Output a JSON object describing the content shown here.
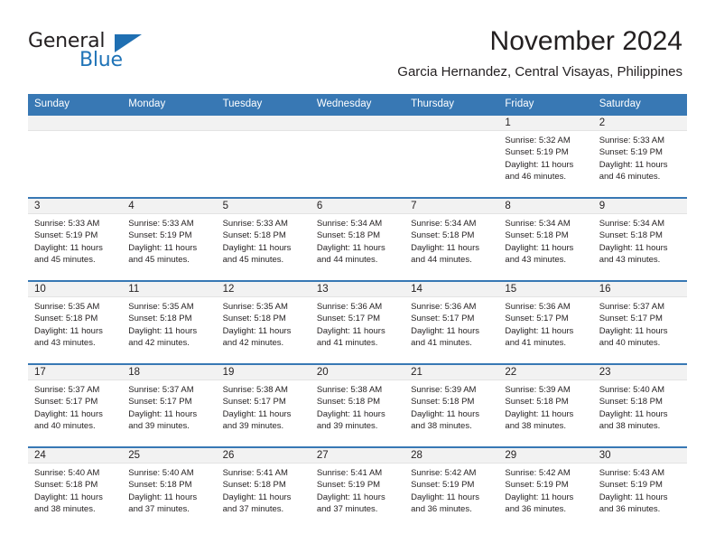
{
  "brand": {
    "word_top": "General",
    "word_bottom": "Blue",
    "triangle_color": "#1f6fb2",
    "blue_color": "#1f73b7"
  },
  "header": {
    "month_year": "November 2024",
    "location": "Garcia Hernandez, Central Visayas, Philippines",
    "header_bg_color": "#3878b4",
    "daynum_bg_color": "#f2f2f2"
  },
  "weekday_headers": [
    "Sunday",
    "Monday",
    "Tuesday",
    "Wednesday",
    "Thursday",
    "Friday",
    "Saturday"
  ],
  "weeks": [
    [
      {
        "day": "",
        "sunrise": "",
        "sunset": "",
        "daylight_line1": "",
        "daylight_line2": ""
      },
      {
        "day": "",
        "sunrise": "",
        "sunset": "",
        "daylight_line1": "",
        "daylight_line2": ""
      },
      {
        "day": "",
        "sunrise": "",
        "sunset": "",
        "daylight_line1": "",
        "daylight_line2": ""
      },
      {
        "day": "",
        "sunrise": "",
        "sunset": "",
        "daylight_line1": "",
        "daylight_line2": ""
      },
      {
        "day": "",
        "sunrise": "",
        "sunset": "",
        "daylight_line1": "",
        "daylight_line2": ""
      },
      {
        "day": "1",
        "sunrise": "Sunrise: 5:32 AM",
        "sunset": "Sunset: 5:19 PM",
        "daylight_line1": "Daylight: 11 hours",
        "daylight_line2": "and 46 minutes."
      },
      {
        "day": "2",
        "sunrise": "Sunrise: 5:33 AM",
        "sunset": "Sunset: 5:19 PM",
        "daylight_line1": "Daylight: 11 hours",
        "daylight_line2": "and 46 minutes."
      }
    ],
    [
      {
        "day": "3",
        "sunrise": "Sunrise: 5:33 AM",
        "sunset": "Sunset: 5:19 PM",
        "daylight_line1": "Daylight: 11 hours",
        "daylight_line2": "and 45 minutes."
      },
      {
        "day": "4",
        "sunrise": "Sunrise: 5:33 AM",
        "sunset": "Sunset: 5:19 PM",
        "daylight_line1": "Daylight: 11 hours",
        "daylight_line2": "and 45 minutes."
      },
      {
        "day": "5",
        "sunrise": "Sunrise: 5:33 AM",
        "sunset": "Sunset: 5:18 PM",
        "daylight_line1": "Daylight: 11 hours",
        "daylight_line2": "and 45 minutes."
      },
      {
        "day": "6",
        "sunrise": "Sunrise: 5:34 AM",
        "sunset": "Sunset: 5:18 PM",
        "daylight_line1": "Daylight: 11 hours",
        "daylight_line2": "and 44 minutes."
      },
      {
        "day": "7",
        "sunrise": "Sunrise: 5:34 AM",
        "sunset": "Sunset: 5:18 PM",
        "daylight_line1": "Daylight: 11 hours",
        "daylight_line2": "and 44 minutes."
      },
      {
        "day": "8",
        "sunrise": "Sunrise: 5:34 AM",
        "sunset": "Sunset: 5:18 PM",
        "daylight_line1": "Daylight: 11 hours",
        "daylight_line2": "and 43 minutes."
      },
      {
        "day": "9",
        "sunrise": "Sunrise: 5:34 AM",
        "sunset": "Sunset: 5:18 PM",
        "daylight_line1": "Daylight: 11 hours",
        "daylight_line2": "and 43 minutes."
      }
    ],
    [
      {
        "day": "10",
        "sunrise": "Sunrise: 5:35 AM",
        "sunset": "Sunset: 5:18 PM",
        "daylight_line1": "Daylight: 11 hours",
        "daylight_line2": "and 43 minutes."
      },
      {
        "day": "11",
        "sunrise": "Sunrise: 5:35 AM",
        "sunset": "Sunset: 5:18 PM",
        "daylight_line1": "Daylight: 11 hours",
        "daylight_line2": "and 42 minutes."
      },
      {
        "day": "12",
        "sunrise": "Sunrise: 5:35 AM",
        "sunset": "Sunset: 5:18 PM",
        "daylight_line1": "Daylight: 11 hours",
        "daylight_line2": "and 42 minutes."
      },
      {
        "day": "13",
        "sunrise": "Sunrise: 5:36 AM",
        "sunset": "Sunset: 5:17 PM",
        "daylight_line1": "Daylight: 11 hours",
        "daylight_line2": "and 41 minutes."
      },
      {
        "day": "14",
        "sunrise": "Sunrise: 5:36 AM",
        "sunset": "Sunset: 5:17 PM",
        "daylight_line1": "Daylight: 11 hours",
        "daylight_line2": "and 41 minutes."
      },
      {
        "day": "15",
        "sunrise": "Sunrise: 5:36 AM",
        "sunset": "Sunset: 5:17 PM",
        "daylight_line1": "Daylight: 11 hours",
        "daylight_line2": "and 41 minutes."
      },
      {
        "day": "16",
        "sunrise": "Sunrise: 5:37 AM",
        "sunset": "Sunset: 5:17 PM",
        "daylight_line1": "Daylight: 11 hours",
        "daylight_line2": "and 40 minutes."
      }
    ],
    [
      {
        "day": "17",
        "sunrise": "Sunrise: 5:37 AM",
        "sunset": "Sunset: 5:17 PM",
        "daylight_line1": "Daylight: 11 hours",
        "daylight_line2": "and 40 minutes."
      },
      {
        "day": "18",
        "sunrise": "Sunrise: 5:37 AM",
        "sunset": "Sunset: 5:17 PM",
        "daylight_line1": "Daylight: 11 hours",
        "daylight_line2": "and 39 minutes."
      },
      {
        "day": "19",
        "sunrise": "Sunrise: 5:38 AM",
        "sunset": "Sunset: 5:17 PM",
        "daylight_line1": "Daylight: 11 hours",
        "daylight_line2": "and 39 minutes."
      },
      {
        "day": "20",
        "sunrise": "Sunrise: 5:38 AM",
        "sunset": "Sunset: 5:18 PM",
        "daylight_line1": "Daylight: 11 hours",
        "daylight_line2": "and 39 minutes."
      },
      {
        "day": "21",
        "sunrise": "Sunrise: 5:39 AM",
        "sunset": "Sunset: 5:18 PM",
        "daylight_line1": "Daylight: 11 hours",
        "daylight_line2": "and 38 minutes."
      },
      {
        "day": "22",
        "sunrise": "Sunrise: 5:39 AM",
        "sunset": "Sunset: 5:18 PM",
        "daylight_line1": "Daylight: 11 hours",
        "daylight_line2": "and 38 minutes."
      },
      {
        "day": "23",
        "sunrise": "Sunrise: 5:40 AM",
        "sunset": "Sunset: 5:18 PM",
        "daylight_line1": "Daylight: 11 hours",
        "daylight_line2": "and 38 minutes."
      }
    ],
    [
      {
        "day": "24",
        "sunrise": "Sunrise: 5:40 AM",
        "sunset": "Sunset: 5:18 PM",
        "daylight_line1": "Daylight: 11 hours",
        "daylight_line2": "and 38 minutes."
      },
      {
        "day": "25",
        "sunrise": "Sunrise: 5:40 AM",
        "sunset": "Sunset: 5:18 PM",
        "daylight_line1": "Daylight: 11 hours",
        "daylight_line2": "and 37 minutes."
      },
      {
        "day": "26",
        "sunrise": "Sunrise: 5:41 AM",
        "sunset": "Sunset: 5:18 PM",
        "daylight_line1": "Daylight: 11 hours",
        "daylight_line2": "and 37 minutes."
      },
      {
        "day": "27",
        "sunrise": "Sunrise: 5:41 AM",
        "sunset": "Sunset: 5:19 PM",
        "daylight_line1": "Daylight: 11 hours",
        "daylight_line2": "and 37 minutes."
      },
      {
        "day": "28",
        "sunrise": "Sunrise: 5:42 AM",
        "sunset": "Sunset: 5:19 PM",
        "daylight_line1": "Daylight: 11 hours",
        "daylight_line2": "and 36 minutes."
      },
      {
        "day": "29",
        "sunrise": "Sunrise: 5:42 AM",
        "sunset": "Sunset: 5:19 PM",
        "daylight_line1": "Daylight: 11 hours",
        "daylight_line2": "and 36 minutes."
      },
      {
        "day": "30",
        "sunrise": "Sunrise: 5:43 AM",
        "sunset": "Sunset: 5:19 PM",
        "daylight_line1": "Daylight: 11 hours",
        "daylight_line2": "and 36 minutes."
      }
    ]
  ]
}
